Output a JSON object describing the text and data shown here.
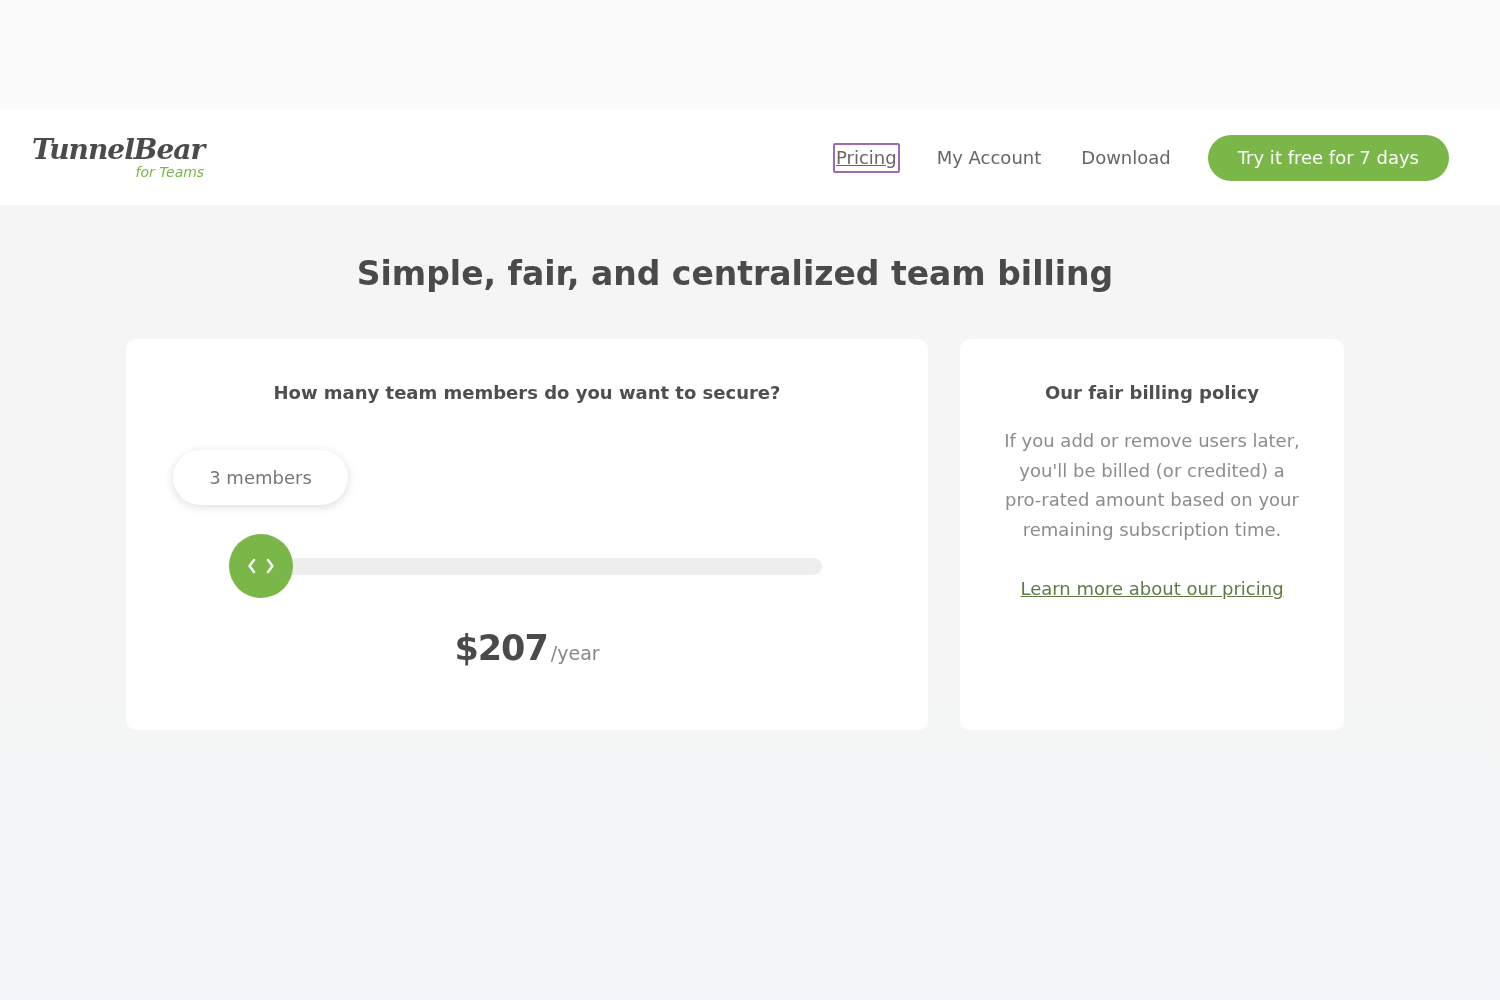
{
  "header": {
    "logo": {
      "name": "TunnelBear",
      "tagline": "for Teams"
    },
    "nav": [
      {
        "label": "Pricing",
        "focused": true
      },
      {
        "label": "My Account",
        "focused": false
      },
      {
        "label": "Download",
        "focused": false
      }
    ],
    "cta": "Try it free for 7 days"
  },
  "heading": "Simple, fair, and centralized team billing",
  "calculator": {
    "question": "How many team members do you want to secure?",
    "slider": {
      "tooltip": "3 members",
      "level": 0
    },
    "price": {
      "amount": "$207",
      "period": "/year"
    }
  },
  "policy": {
    "title": "Our fair billing policy",
    "body": "If you add or remove users later, you'll be billed (or credited) a pro-rated amount based on your remaining subscription time.",
    "link": "Learn more about our pricing"
  }
}
